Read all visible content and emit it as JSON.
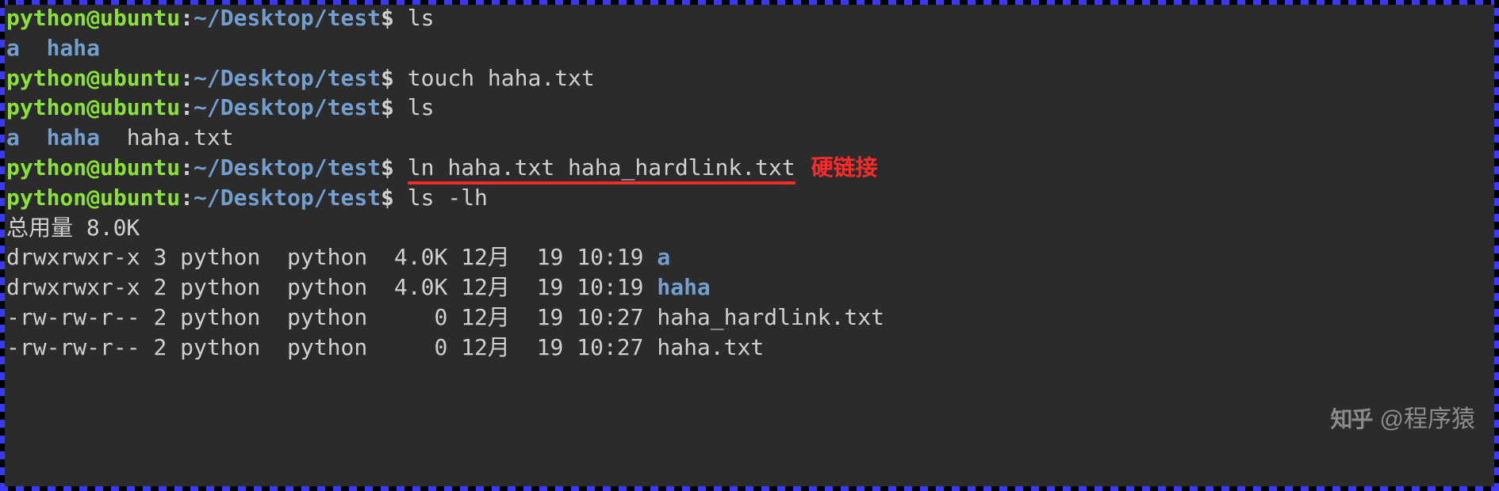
{
  "prompt": {
    "user": "python",
    "host": "ubuntu",
    "path": "~/Desktop/test",
    "symbol": "$"
  },
  "lines": [
    {
      "type": "cmd",
      "command": "ls"
    },
    {
      "type": "out-dirs",
      "items": [
        "a",
        "haha"
      ]
    },
    {
      "type": "cmd",
      "command": "touch haha.txt"
    },
    {
      "type": "cmd",
      "command": "ls"
    },
    {
      "type": "out-mixed",
      "dirs": [
        "a",
        "haha"
      ],
      "files": [
        "haha.txt"
      ]
    },
    {
      "type": "cmd-annot",
      "command": "ln haha.txt haha_hardlink.txt",
      "annotation": "硬链接"
    },
    {
      "type": "cmd",
      "command": "ls -lh"
    },
    {
      "type": "out-plain",
      "text": "总用量 8.0K"
    },
    {
      "type": "ls-row",
      "perm": "drwxrwxr-x",
      "links": "3",
      "owner": "python",
      "group": "python",
      "size": "4.0K",
      "date": "12月  19 10:19",
      "name": "a",
      "kind": "dir"
    },
    {
      "type": "ls-row",
      "perm": "drwxrwxr-x",
      "links": "2",
      "owner": "python",
      "group": "python",
      "size": "4.0K",
      "date": "12月  19 10:19",
      "name": "haha",
      "kind": "dir"
    },
    {
      "type": "ls-row",
      "perm": "-rw-rw-r--",
      "links": "2",
      "owner": "python",
      "group": "python",
      "size": "   0",
      "date": "12月  19 10:27",
      "name": "haha_hardlink.txt",
      "kind": "file"
    },
    {
      "type": "ls-row",
      "perm": "-rw-rw-r--",
      "links": "2",
      "owner": "python",
      "group": "python",
      "size": "   0",
      "date": "12月  19 10:27",
      "name": "haha.txt",
      "kind": "file"
    }
  ],
  "watermark": {
    "logo": "知乎",
    "text": "@程序猿"
  }
}
